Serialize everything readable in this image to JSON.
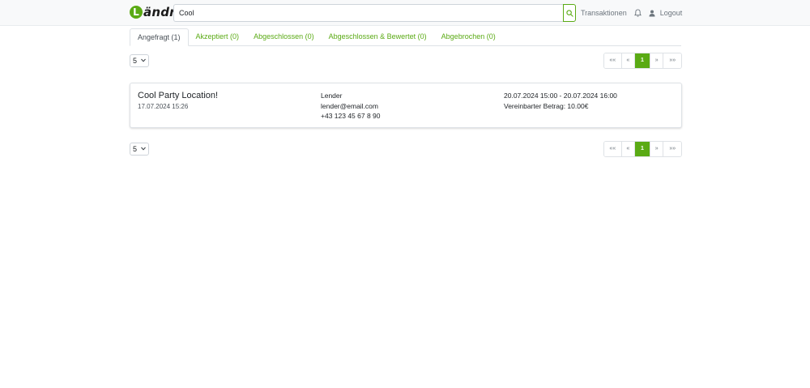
{
  "brand": {
    "logo_letter": "L",
    "logo_text": "ändr",
    "accent": "#5aaa14"
  },
  "search": {
    "value": "Cool",
    "placeholder": ""
  },
  "nav": {
    "transactions": "Transaktionen",
    "logout": "Logout",
    "icons": [
      "bell-icon",
      "user-icon"
    ]
  },
  "tabs": [
    {
      "label": "Angefragt (1)",
      "active": true
    },
    {
      "label": "Akzeptiert (0)",
      "active": false
    },
    {
      "label": "Abgeschlossen (0)",
      "active": false
    },
    {
      "label": "Abgeschlossen & Bewertet (0)",
      "active": false
    },
    {
      "label": "Abgebrochen (0)",
      "active": false
    }
  ],
  "page_size": {
    "selected": "5"
  },
  "pagination": {
    "first": "««",
    "prev": "«",
    "current": "1",
    "next": "»",
    "last": "»»"
  },
  "transaction": {
    "title": "Cool Party Location!",
    "created": "17.07.2024 15:26",
    "lender_name": "Lender",
    "lender_email": "lender@email.com",
    "lender_phone": "+43 123 45 67 8 90",
    "period": "20.07.2024 15:00 - 20.07.2024 16:00",
    "price": "Vereinbarter Betrag: 10.00€"
  }
}
